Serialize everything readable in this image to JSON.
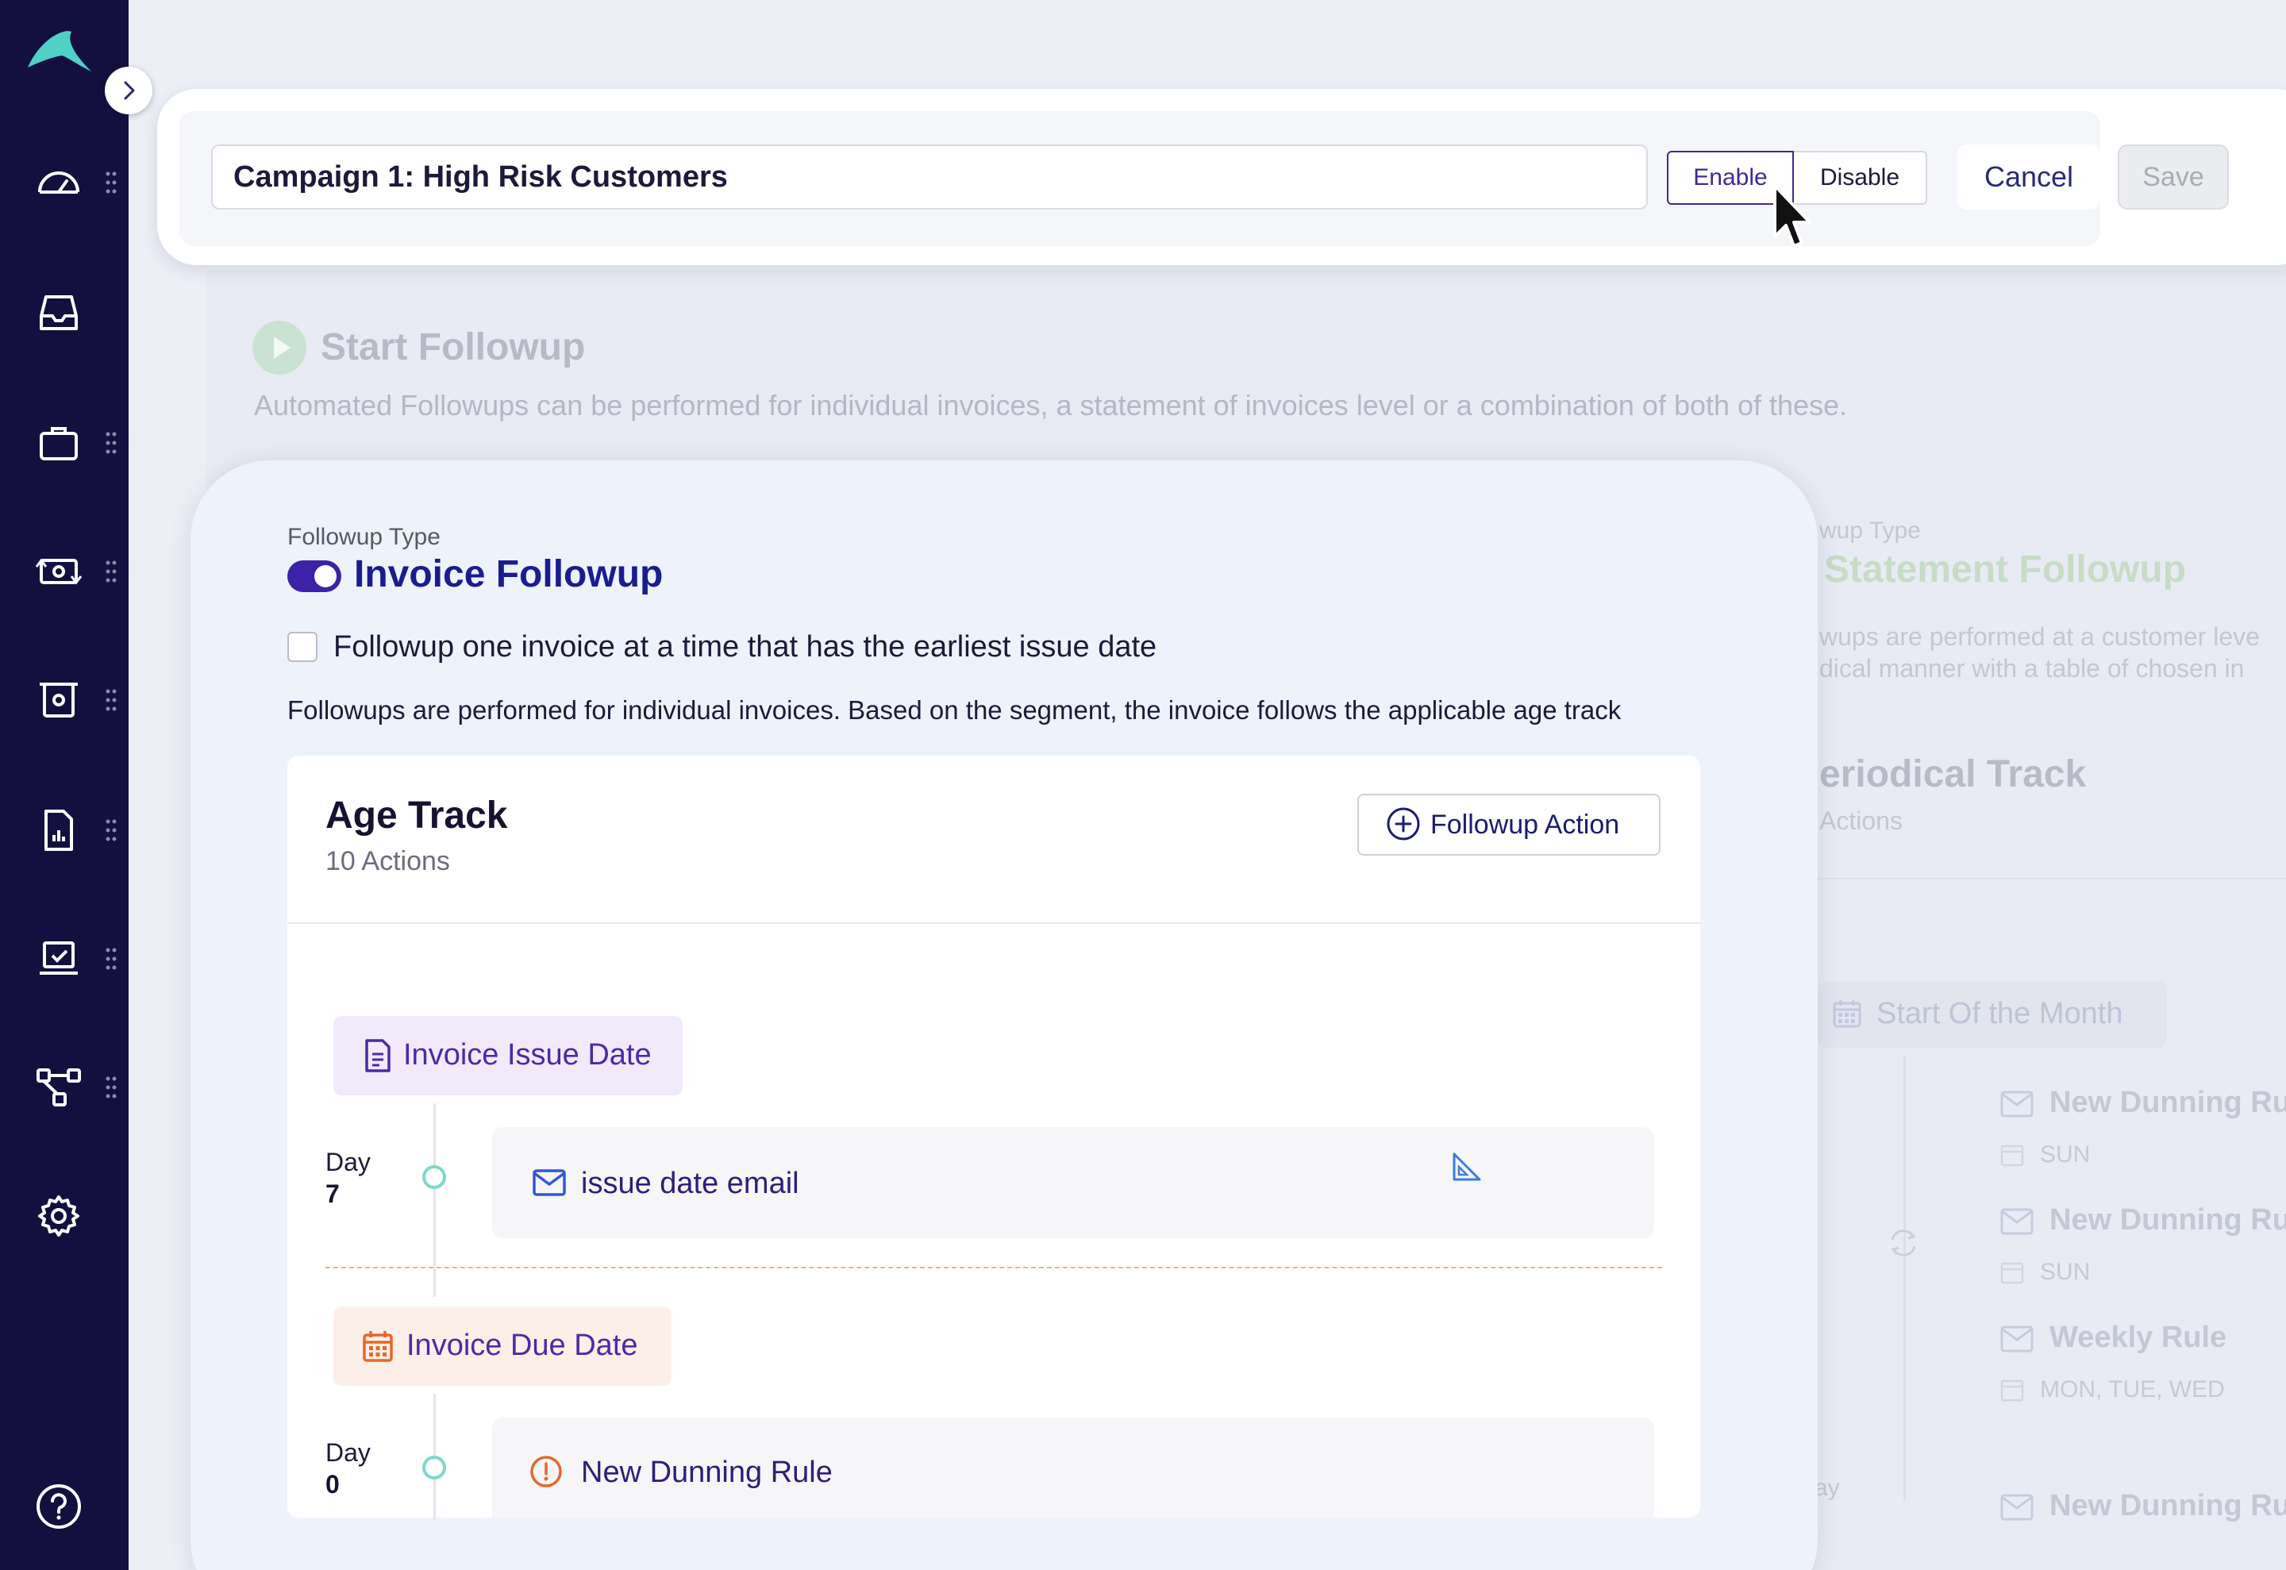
{
  "header": {
    "campaign_name": "Campaign 1: High Risk Customers",
    "enable_label": "Enable",
    "disable_label": "Disable",
    "cancel_label": "Cancel",
    "save_label": "Save"
  },
  "background": {
    "start_title": "Start Followup",
    "start_description": "Automated Followups can be performed for individual invoices, a statement of invoices level or a combination of both of these.",
    "statement_label": "wup Type",
    "statement_title": "Statement Followup",
    "statement_desc_1": "wups are performed at a customer leve",
    "statement_desc_2": "dical manner with a table of chosen in",
    "periodical_title": "eriodical Track",
    "periodical_actions": "Actions",
    "month_chip": "Start Of the Month",
    "rules": [
      {
        "name": "New Dunning Ru",
        "days": "SUN"
      },
      {
        "name": "New Dunning Ru",
        "days": "SUN"
      },
      {
        "name": "Weekly Rule",
        "days": "MON, TUE, WED"
      },
      {
        "name": "New Dunning Ru",
        "days": ""
      }
    ],
    "ay_fragment": "ay"
  },
  "followup": {
    "type_label": "Followup Type",
    "type_title": "Invoice Followup",
    "checkbox_label": "Followup one invoice at a time that has the earliest issue date",
    "description": "Followups are performed for individual invoices. Based on the segment, the invoice follows the applicable age track"
  },
  "age_track": {
    "title": "Age Track",
    "count": "10 Actions",
    "add_action_label": "Followup Action",
    "milestones": [
      {
        "label": "Invoice Issue Date",
        "day_label": "Day",
        "day": "7",
        "action": "issue date email"
      },
      {
        "label": "Invoice Due Date",
        "day_label": "Day",
        "day": "0",
        "action": "New Dunning Rule"
      }
    ]
  },
  "colors": {
    "sidebar": "#13103f",
    "accent": "#3b22a8",
    "teal": "#7fd8cc",
    "orange": "#e8672a"
  }
}
